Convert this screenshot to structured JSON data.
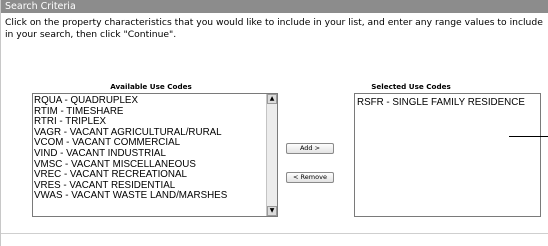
{
  "panel": {
    "title": "Search Criteria",
    "instructions": "Click on the property characteristics that you would like to include in your list, and enter any range values to include in your search, then click \"Continue\"."
  },
  "available": {
    "heading": "Available Use Codes",
    "items": [
      "RQUA - QUADRUPLEX",
      "RTIM - TIMESHARE",
      "RTRI - TRIPLEX",
      "VAGR - VACANT AGRICULTURAL/RURAL",
      "VCOM - VACANT COMMERCIAL",
      "VIND - VACANT INDUSTRIAL",
      "VMSC - VACANT MISCELLANEOUS",
      "VREC - VACANT RECREATIONAL",
      "VRES - VACANT RESIDENTIAL",
      "VWAS - VACANT WASTE LAND/MARSHES"
    ]
  },
  "selected": {
    "heading": "Selected Use Codes",
    "items": [
      "RSFR - SINGLE FAMILY RESIDENCE"
    ]
  },
  "buttons": {
    "add": "Add >",
    "remove": "< Remove"
  },
  "icons": {
    "scroll_up": "scroll-up-arrow-icon",
    "scroll_down": "scroll-down-arrow-icon"
  }
}
